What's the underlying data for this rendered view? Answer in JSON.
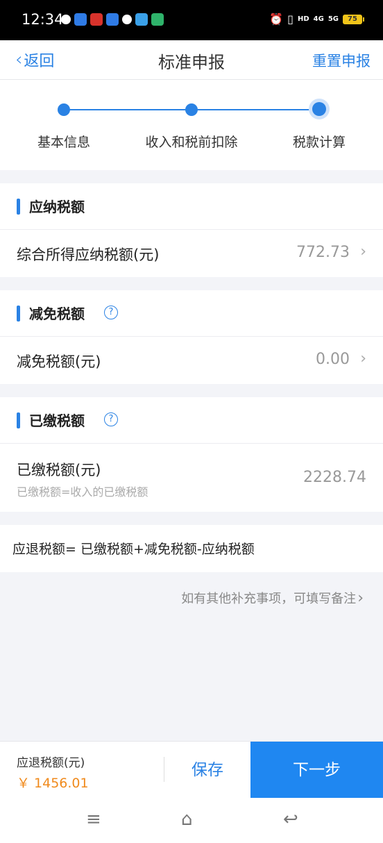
{
  "status_bar": {
    "time": "12:34",
    "battery": "75",
    "signal_4g": "4G",
    "signal_5g": "5G",
    "hd": "HD"
  },
  "header": {
    "back_label": "返回",
    "title": "标准申报",
    "reset_label": "重置申报"
  },
  "steps": [
    {
      "label": "基本信息"
    },
    {
      "label": "收入和税前扣除"
    },
    {
      "label": "税款计算"
    }
  ],
  "sections": {
    "payable": {
      "title": "应纳税额",
      "row_label": "综合所得应纳税额(元)",
      "row_value": "772.73"
    },
    "exempt": {
      "title": "减免税额",
      "row_label": "减免税额(元)",
      "row_value": "0.00"
    },
    "paid": {
      "title": "已缴税额",
      "row_label": "已缴税额(元)",
      "row_sublabel": "已缴税额=收入的已缴税额",
      "row_value": "2228.74"
    }
  },
  "formula": "应退税额= 已缴税额+减免税额-应纳税额",
  "note": "如有其他补充事项，可填写备注",
  "bottom": {
    "refund_label": "应退税额(元)",
    "refund_value": "￥ 1456.01",
    "save_label": "保存",
    "next_label": "下一步"
  },
  "colors": {
    "accent": "#2a82e4",
    "primary_button": "#1f87f1",
    "refund_amount": "#f08a1c",
    "background": "#f3f4f8"
  }
}
